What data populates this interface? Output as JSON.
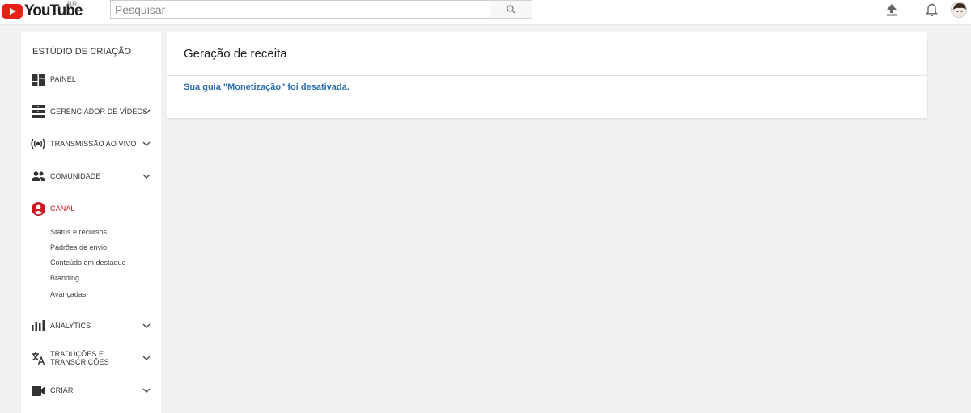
{
  "header": {
    "logo_text": "YouTube",
    "region": "BR",
    "search_placeholder": "Pesquisar",
    "icons": [
      "search-icon",
      "upload-icon",
      "bell-icon",
      "avatar"
    ]
  },
  "sidebar": {
    "title": "ESTÚDIO DE CRIAÇÃO",
    "items": [
      {
        "label": "PAINEL",
        "icon": "dashboard-icon",
        "expandable": false
      },
      {
        "label": "GERENCIADOR DE VÍDEOS",
        "icon": "video-manager-icon",
        "expandable": true
      },
      {
        "label": "TRANSMISSÃO AO VIVO",
        "icon": "live-icon",
        "expandable": true
      },
      {
        "label": "COMUNIDADE",
        "icon": "community-icon",
        "expandable": true
      },
      {
        "label": "CANAL",
        "icon": "channel-icon",
        "expandable": false,
        "active": true
      },
      {
        "label": "ANALYTICS",
        "icon": "analytics-icon",
        "expandable": true
      },
      {
        "label": "TRADUÇÕES E\nTRANSCRIÇÕES",
        "icon": "translate-icon",
        "expandable": true
      },
      {
        "label": "CRIAR",
        "icon": "create-icon",
        "expandable": true
      }
    ],
    "channel_subitems": [
      "Status e recursos",
      "Padrões de envio",
      "Conteúdo em destaque",
      "Branding",
      "Avançadas"
    ]
  },
  "main": {
    "title": "Geração de receita",
    "message": "Sua guia \"Monetização\" foi desativada."
  },
  "colors": {
    "accent_red": "#cc181e",
    "link_blue": "#2b6dad",
    "page_bg": "#f1f1f1"
  }
}
